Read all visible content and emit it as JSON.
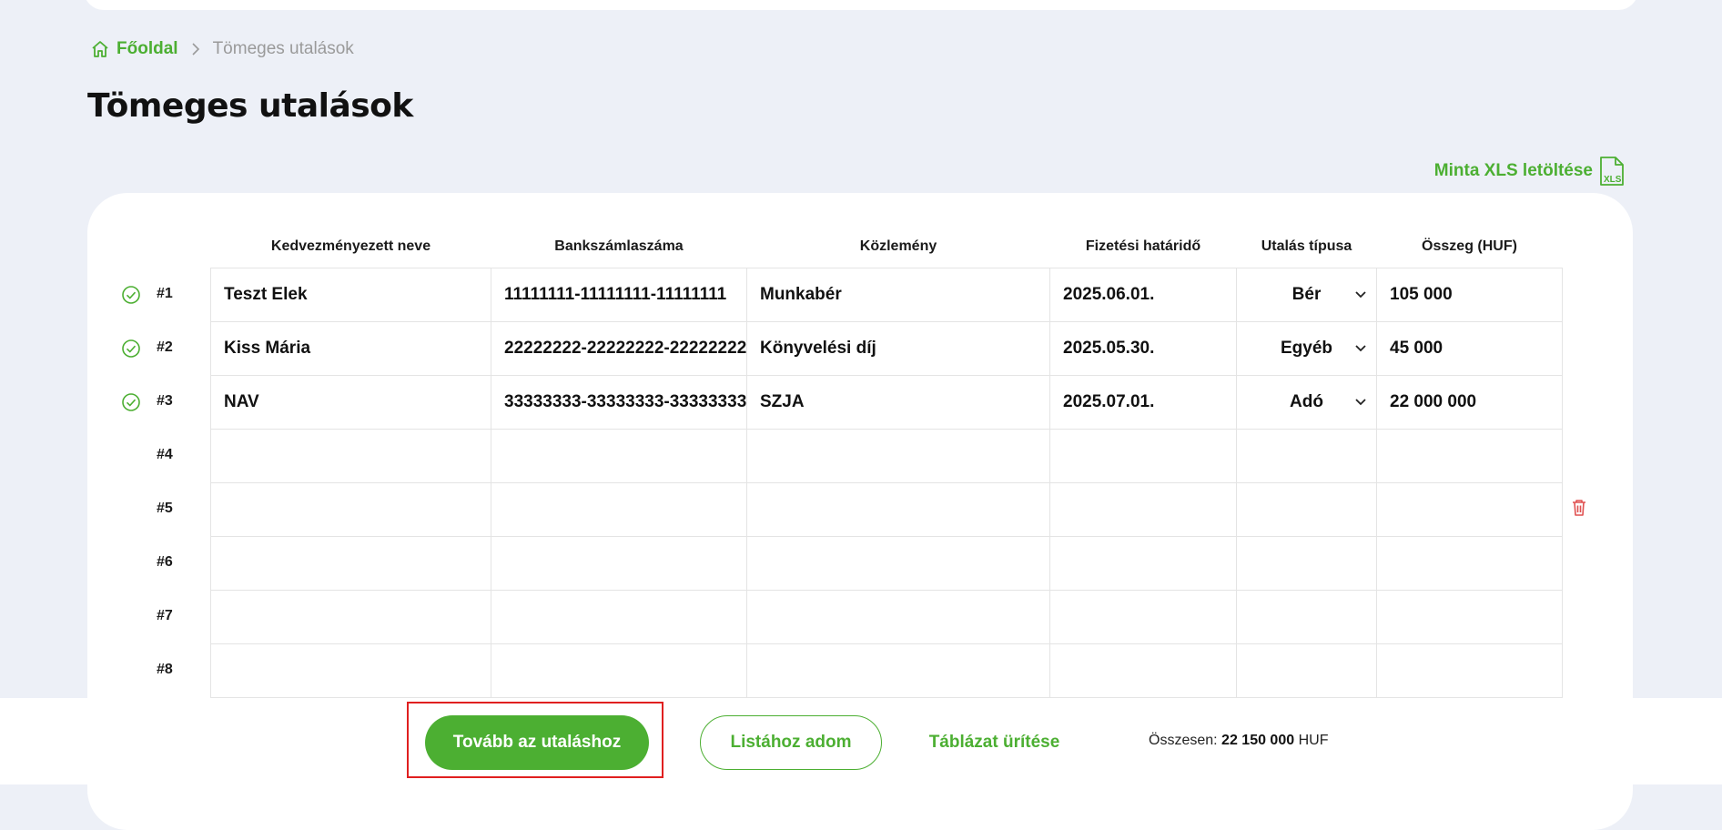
{
  "breadcrumb": {
    "home": "Főoldal",
    "current": "Tömeges utalások"
  },
  "page": {
    "title": "Tömeges utalások"
  },
  "download": {
    "label": "Minta XLS letöltése",
    "icon_text": "XLS"
  },
  "table": {
    "columns": [
      "Kedvezményezett neve",
      "Bankszámlaszáma",
      "Közlemény",
      "Fizetési határidő",
      "Utalás típusa",
      "Összeg (HUF)"
    ],
    "rows": [
      {
        "num": "#1",
        "valid": true,
        "name": "Teszt Elek",
        "account": "11111111-11111111-11111111",
        "note": "Munkabér",
        "due": "2025.06.01.",
        "type": "Bér",
        "amount": "105 000"
      },
      {
        "num": "#2",
        "valid": true,
        "name": "Kiss Mária",
        "account": "22222222-22222222-22222222",
        "note": "Könyvelési díj",
        "due": "2025.05.30.",
        "type": "Egyéb",
        "amount": "45 000"
      },
      {
        "num": "#3",
        "valid": true,
        "name": "NAV",
        "account": "33333333-33333333-33333333",
        "note": "SZJA",
        "due": "2025.07.01.",
        "type": "Adó",
        "amount": "22 000 000"
      },
      {
        "num": "#4",
        "valid": false,
        "name": "",
        "account": "",
        "note": "",
        "due": "",
        "type": "",
        "amount": ""
      },
      {
        "num": "#5",
        "valid": false,
        "name": "",
        "account": "",
        "note": "",
        "due": "",
        "type": "",
        "amount": ""
      },
      {
        "num": "#6",
        "valid": false,
        "name": "",
        "account": "",
        "note": "",
        "due": "",
        "type": "",
        "amount": ""
      },
      {
        "num": "#7",
        "valid": false,
        "name": "",
        "account": "",
        "note": "",
        "due": "",
        "type": "",
        "amount": ""
      },
      {
        "num": "#8",
        "valid": false,
        "name": "",
        "account": "",
        "note": "",
        "due": "",
        "type": "",
        "amount": ""
      }
    ]
  },
  "actions": {
    "continue": "Tovább az utaláshoz",
    "add_to_list": "Listához adom",
    "clear": "Táblázat ürítése"
  },
  "summary": {
    "label": "Összesen:",
    "amount": "22 150 000",
    "currency": "HUF"
  },
  "colors": {
    "accent": "#4caf32",
    "highlight": "#e02020",
    "delete": "#e05050",
    "background": "#edf0f7"
  },
  "icons": [
    "home-icon",
    "chevron-right-icon",
    "xls-file-icon",
    "check-circle-icon",
    "chevron-down-icon",
    "trash-icon"
  ]
}
